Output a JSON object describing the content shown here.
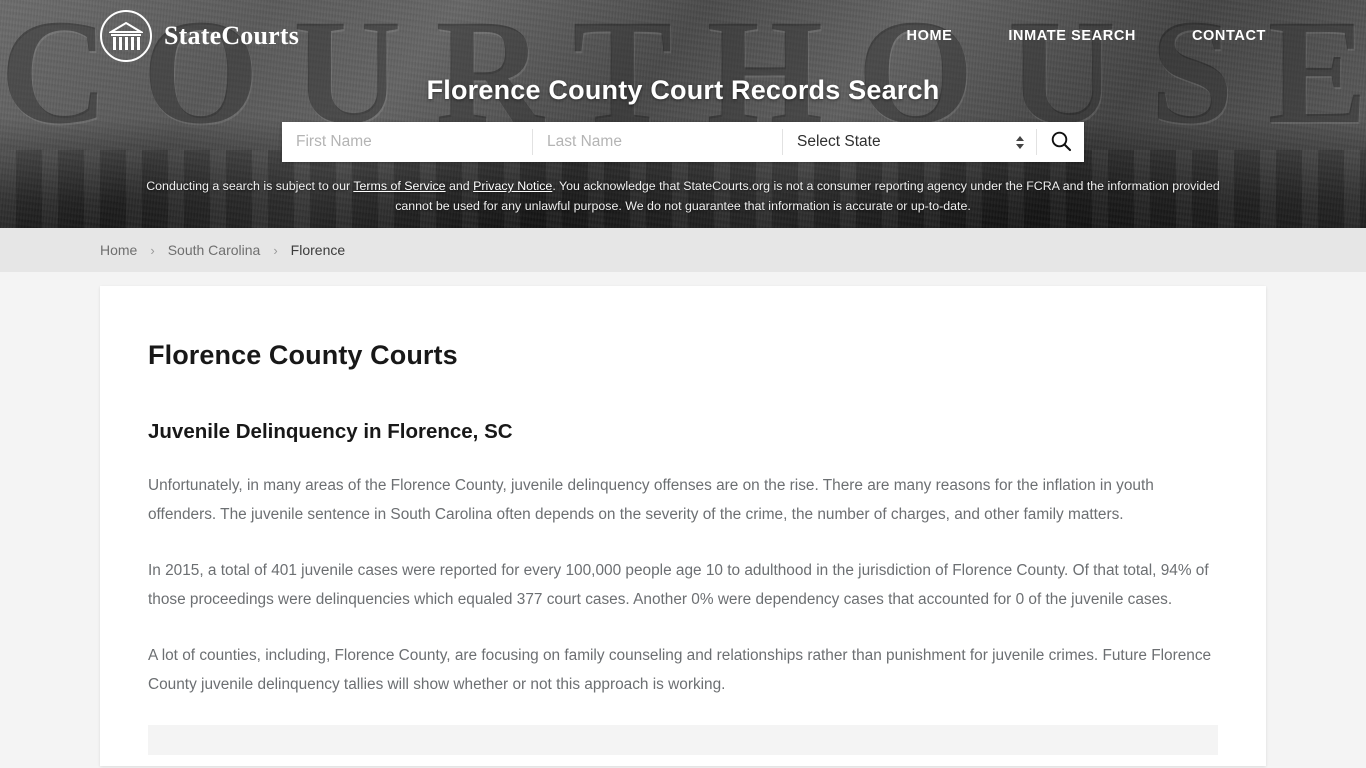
{
  "brand": {
    "name": "StateCourts",
    "logo_icon": "courthouse-circle-icon"
  },
  "nav": [
    {
      "label": "HOME",
      "name": "nav-home"
    },
    {
      "label": "INMATE SEARCH",
      "name": "nav-inmate-search"
    },
    {
      "label": "CONTACT",
      "name": "nav-contact"
    }
  ],
  "hero": {
    "title": "Florence County Court Records Search",
    "background_letters": "COURTHOUSE"
  },
  "search": {
    "first_name_placeholder": "First Name",
    "first_name_value": "",
    "last_name_placeholder": "Last Name",
    "last_name_value": "",
    "state_selected": "Select State",
    "submit_icon": "search-icon",
    "stepper_icon": "chevron-updown-icon"
  },
  "disclaimer": {
    "part1": "Conducting a search is subject to our ",
    "link1": "Terms of Service",
    "part2": " and ",
    "link2": "Privacy Notice",
    "part3": ". You acknowledge that StateCourts.org is not a consumer reporting agency under the FCRA and the information provided cannot be used for any unlawful purpose. We do not guarantee that information is accurate or up-to-date."
  },
  "breadcrumb": {
    "items": [
      {
        "label": "Home"
      },
      {
        "label": "South Carolina"
      },
      {
        "label": "Florence"
      }
    ],
    "separator": "›"
  },
  "main": {
    "page_title": "Florence County Courts",
    "section_title": "Juvenile Delinquency in Florence, SC",
    "paragraphs": [
      "Unfortunately, in many areas of the Florence County, juvenile delinquency offenses are on the rise. There are many reasons for the inflation in youth offenders. The juvenile sentence in South Carolina often depends on the severity of the crime, the number of charges, and other family matters.",
      "In 2015, a total of 401 juvenile cases were reported for every 100,000 people age 10 to adulthood in the jurisdiction of Florence County. Of that total, 94% of those proceedings were delinquencies which equaled 377 court cases. Another 0% were dependency cases that accounted for 0 of the juvenile cases.",
      "A lot of counties, including, Florence County, are focusing on family counseling and relationships rather than punishment for juvenile crimes. Future Florence County juvenile delinquency tallies will show whether or not this approach is working."
    ]
  },
  "colors": {
    "hero_overlay": "#4a4a4a",
    "breadcrumb_bg": "#e6e6e6",
    "page_bg": "#f4f4f4",
    "card_bg": "#ffffff",
    "body_text": "#6c6f72",
    "heading_text": "#181818"
  }
}
